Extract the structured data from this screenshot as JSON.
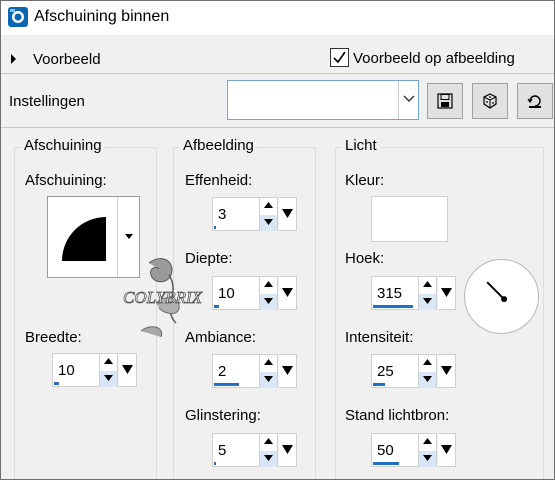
{
  "window": {
    "title": "Afschuining binnen"
  },
  "preview": {
    "toggle_label": "Voorbeeld",
    "on_image_label": "Voorbeeld op afbeelding",
    "on_image_checked": true
  },
  "settings": {
    "label": "Instellingen",
    "preset_value": ""
  },
  "toolbar": {
    "save_icon": "save-icon",
    "random_icon": "dice-icon",
    "reset_icon": "reset-icon"
  },
  "groups": {
    "bevel": {
      "title": "Afschuining",
      "shape_label": "Afschuining:",
      "width_label": "Breedte:",
      "width_value": "10",
      "width_fill": 0.1
    },
    "image": {
      "title": "Afbeelding",
      "smoothness_label": "Effenheid:",
      "smoothness_value": "3",
      "smoothness_fill": 0.03,
      "depth_label": "Diepte:",
      "depth_value": "10",
      "depth_fill": 0.1,
      "ambience_label": "Ambiance:",
      "ambience_value": "2",
      "ambience_fill": 0.55,
      "shininess_label": "Glinstering:",
      "shininess_value": "5",
      "shininess_fill": 0.05
    },
    "light": {
      "title": "Licht",
      "color_label": "Kleur:",
      "color_value": "#ffffff",
      "angle_label": "Hoek:",
      "angle_value": "315",
      "angle_fill": 0.875,
      "intensity_label": "Intensiteit:",
      "intensity_value": "25",
      "intensity_fill": 0.25,
      "elevation_label": "Stand lichtbron:",
      "elevation_value": "50",
      "elevation_fill": 0.56
    }
  },
  "watermark": "COLYBRIX",
  "colors": {
    "accent": "#1e6fc8",
    "spin_down_bg": "#d8e6f5"
  }
}
